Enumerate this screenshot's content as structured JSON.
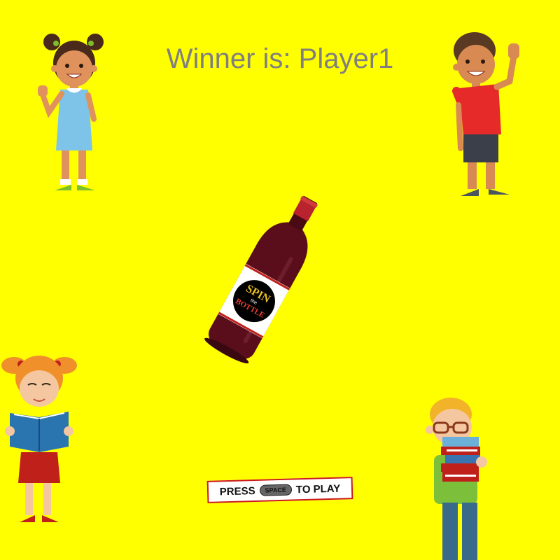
{
  "winner": {
    "text": "Winner is: Player1"
  },
  "bottle_label": {
    "line1": "SPIN",
    "line2": "the",
    "line3": "BOTTLE"
  },
  "press": {
    "before": "PRESS",
    "key": "SPACE",
    "after": "TO PLAY"
  },
  "players": [
    {
      "name": "girl-waving",
      "description": "top-left player"
    },
    {
      "name": "boy-waving",
      "description": "top-right player"
    },
    {
      "name": "girl-reading",
      "description": "bottom-left player"
    },
    {
      "name": "boy-with-books",
      "description": "bottom-right player"
    }
  ],
  "colors": {
    "background": "#ffff00",
    "winner_text": "#7f7f7f",
    "banner_border": "#cc1a1a"
  }
}
